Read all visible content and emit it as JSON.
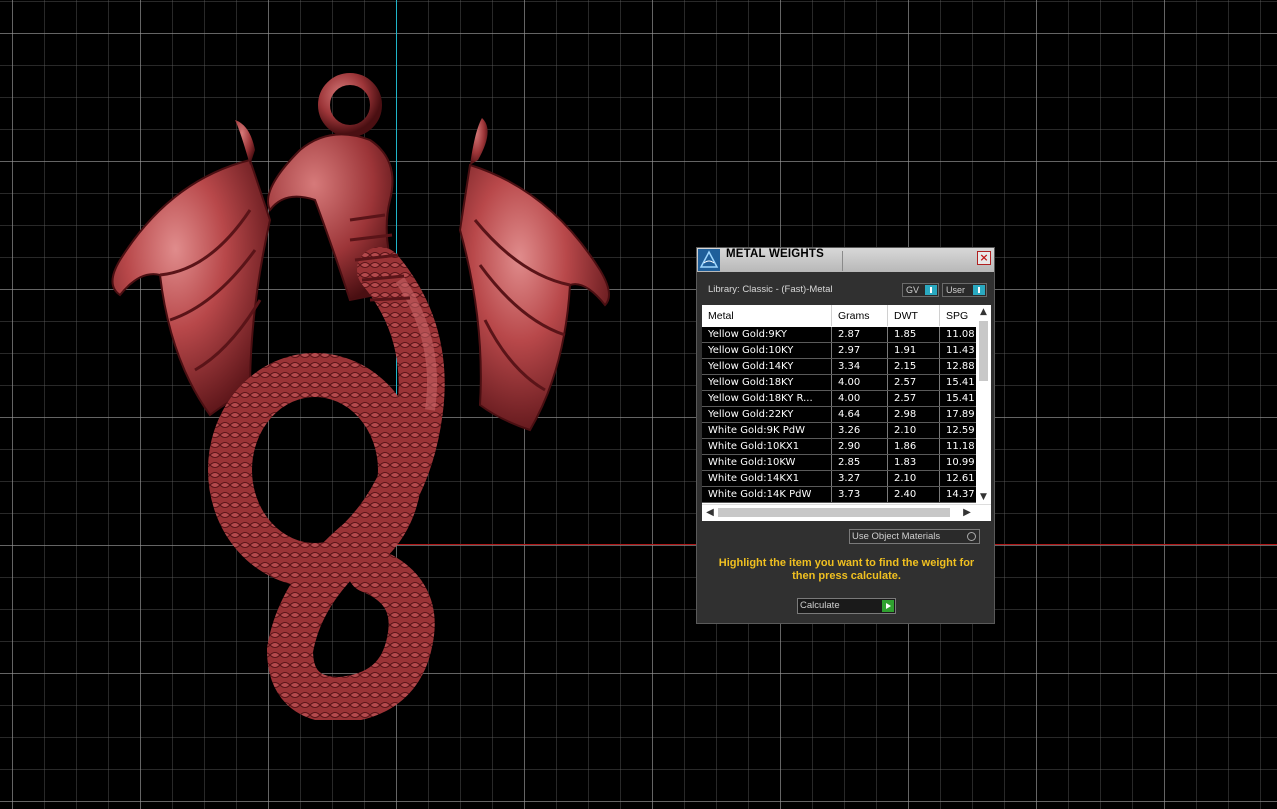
{
  "viewport": {
    "y_axis_color": "#1fb5c9",
    "x_axis_color": "#b01818",
    "model": "dragon-pendant"
  },
  "panel": {
    "title": "METAL WEIGHTS",
    "library_label": "Library: Classic - (Fast)-Metal",
    "toggle_gv": "GV",
    "toggle_user": "User",
    "columns": [
      "Metal",
      "Grams",
      "DWT",
      "SPG"
    ],
    "rows": [
      [
        "Yellow Gold:9KY",
        "2.87",
        "1.85",
        "11.08"
      ],
      [
        "Yellow Gold:10KY",
        "2.97",
        "1.91",
        "11.43"
      ],
      [
        "Yellow Gold:14KY",
        "3.34",
        "2.15",
        "12.88"
      ],
      [
        "Yellow Gold:18KY",
        "4.00",
        "2.57",
        "15.41"
      ],
      [
        "Yellow Gold:18KY R...",
        "4.00",
        "2.57",
        "15.41"
      ],
      [
        "Yellow Gold:22KY",
        "4.64",
        "2.98",
        "17.89"
      ],
      [
        "White Gold:9K PdW",
        "3.26",
        "2.10",
        "12.59"
      ],
      [
        "White Gold:10KX1",
        "2.90",
        "1.86",
        "11.18"
      ],
      [
        "White Gold:10KW",
        "2.85",
        "1.83",
        "10.99"
      ],
      [
        "White Gold:14KX1",
        "3.27",
        "2.10",
        "12.61"
      ],
      [
        "White Gold:14K PdW",
        "3.73",
        "2.40",
        "14.37"
      ]
    ],
    "use_object_materials": "Use Object Materials",
    "hint": "Highlight the item you want to find the weight for then press calculate.",
    "calculate_label": "Calculate",
    "accent_color": "#f0c020"
  }
}
